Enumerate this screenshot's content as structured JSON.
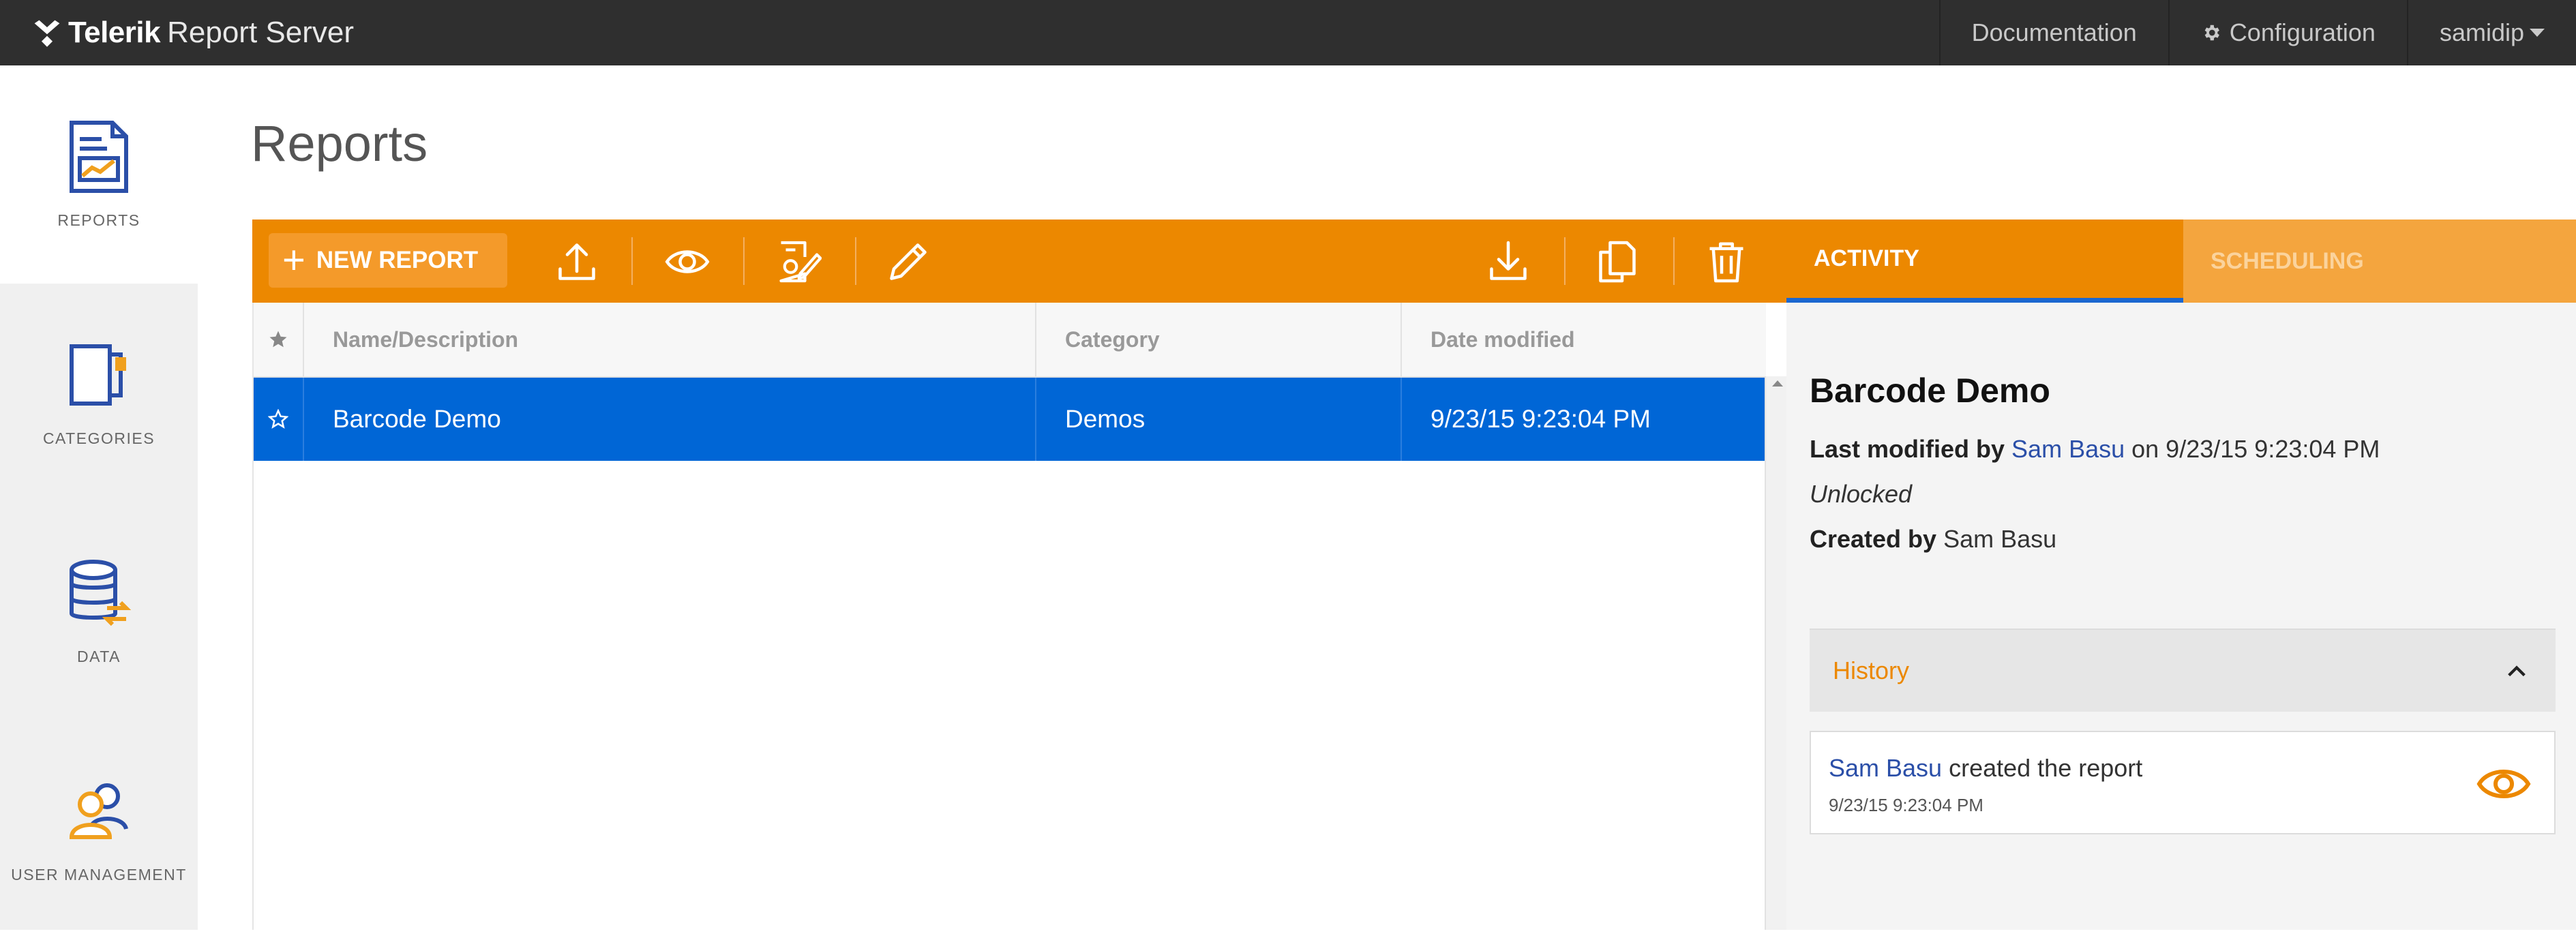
{
  "app": {
    "brand_bold": "Telerik",
    "brand_regular": "Report Server"
  },
  "topnav": {
    "documentation": "Documentation",
    "configuration": "Configuration",
    "user": "samidip"
  },
  "sidebar": {
    "items": [
      {
        "label": "REPORTS",
        "icon": "report-icon"
      },
      {
        "label": "CATEGORIES",
        "icon": "categories-icon"
      },
      {
        "label": "DATA",
        "icon": "database-icon"
      },
      {
        "label": "USER MANAGEMENT",
        "icon": "users-icon"
      }
    ]
  },
  "page": {
    "title": "Reports"
  },
  "toolbar": {
    "new_report_label": "NEW REPORT",
    "icons": [
      "upload-icon",
      "preview-icon",
      "design-icon",
      "edit-icon",
      "download-icon",
      "copy-icon",
      "delete-icon"
    ]
  },
  "grid": {
    "columns": [
      "Name/Description",
      "Category",
      "Date modified"
    ],
    "rows": [
      {
        "name": "Barcode Demo",
        "category": "Demos",
        "date": "9/23/15 9:23:04 PM"
      }
    ]
  },
  "panel": {
    "tabs": {
      "activity": "ACTIVITY",
      "scheduling": "SCHEDULING"
    },
    "report_name": "Barcode Demo",
    "last_modified_label": "Last modified by",
    "last_modified_user": "Sam Basu",
    "last_modified_on": "on 9/23/15 9:23:04 PM",
    "lock_status": "Unlocked",
    "created_by_label": "Created by",
    "created_by_user": "Sam Basu",
    "history": {
      "title": "History",
      "entries": [
        {
          "user": "Sam Basu",
          "action": "created the report",
          "time": "9/23/15 9:23:04 PM"
        }
      ]
    }
  },
  "colors": {
    "accent": "#ec8800",
    "selection": "#0066d6",
    "topbar": "#2f2f2f",
    "link": "#2b4fa8"
  }
}
